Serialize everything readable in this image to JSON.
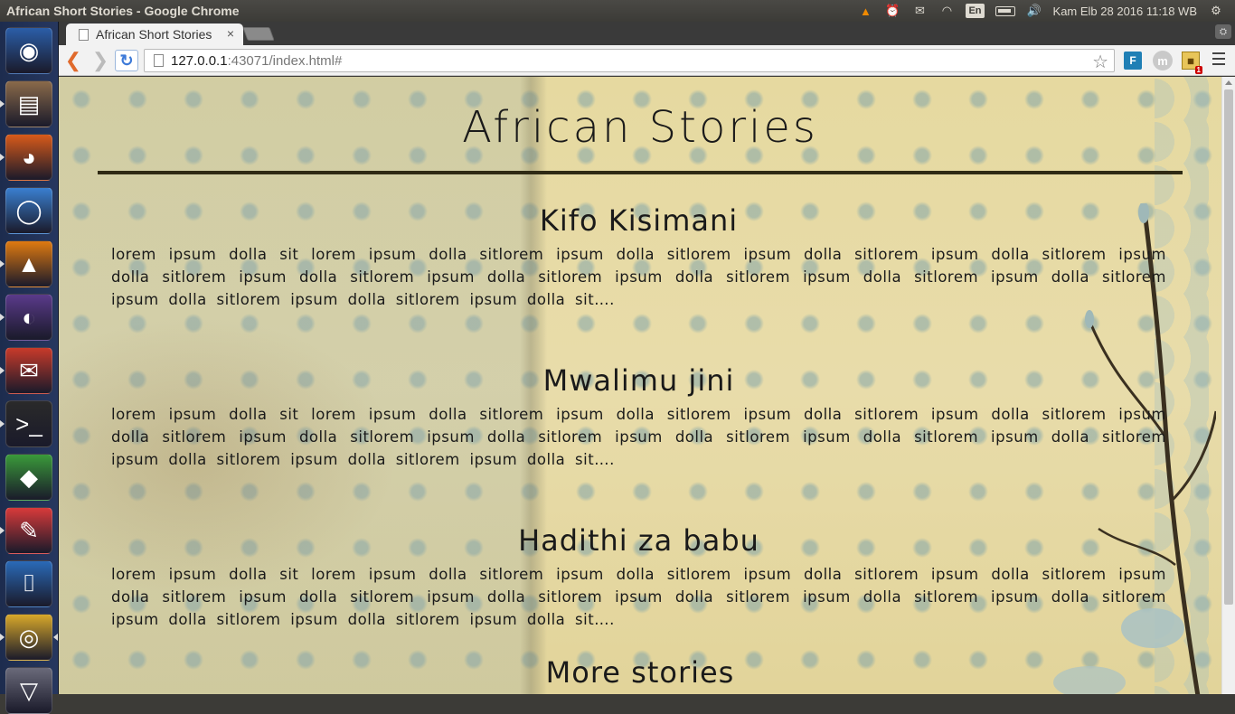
{
  "os": {
    "window_title": "African Short Stories - Google Chrome",
    "language": "En",
    "clock": "Kam Elb 28 2016 11:18 WB"
  },
  "browser": {
    "tab_title": "African Short Stories",
    "tab_close": "×",
    "url_host": "127.0.0.1",
    "url_rest": ":43071/index.html#",
    "extension_f": "F",
    "extension_m": "m",
    "extension_badge": "1"
  },
  "page": {
    "title": "African Stories",
    "stories": [
      {
        "heading": "Kifo Kisimani",
        "body": "lorem ipsum dolla sit lorem ipsum dolla sitlorem ipsum dolla sitlorem ipsum dolla sitlorem ipsum dolla sitlorem ipsum dolla sitlorem ipsum dolla sitlorem ipsum dolla sitlorem ipsum dolla sitlorem ipsum dolla sitlorem ipsum dolla sitlorem ipsum dolla sitlorem ipsum dolla sitlorem ipsum dolla sit…."
      },
      {
        "heading": "Mwalimu jini",
        "body": "lorem ipsum dolla sit lorem ipsum dolla sitlorem ipsum dolla sitlorem ipsum dolla sitlorem ipsum dolla sitlorem ipsum dolla sitlorem ipsum dolla sitlorem ipsum dolla sitlorem ipsum dolla sitlorem ipsum dolla sitlorem ipsum dolla sitlorem ipsum dolla sitlorem ipsum dolla sitlorem ipsum dolla sit…."
      },
      {
        "heading": "Hadithi za babu",
        "body": "lorem ipsum dolla sit lorem ipsum dolla sitlorem ipsum dolla sitlorem ipsum dolla sitlorem ipsum dolla sitlorem ipsum dolla sitlorem ipsum dolla sitlorem ipsum dolla sitlorem ipsum dolla sitlorem ipsum dolla sitlorem ipsum dolla sitlorem ipsum dolla sitlorem ipsum dolla sitlorem ipsum dolla sit…."
      }
    ],
    "more_link": "More stories"
  },
  "launcher_apps": [
    {
      "name": "dash-home-icon",
      "color": "#2b5ea8",
      "glyph": "◉"
    },
    {
      "name": "files-icon",
      "color": "#8a6a4a",
      "glyph": "▤"
    },
    {
      "name": "firefox-icon",
      "color": "#d85a1a",
      "glyph": "◕"
    },
    {
      "name": "chromium-icon",
      "color": "#3a7fd0",
      "glyph": "◯"
    },
    {
      "name": "vlc-icon",
      "color": "#e07a10",
      "glyph": "▲"
    },
    {
      "name": "eclipse-icon",
      "color": "#5a3a8a",
      "glyph": "◐"
    },
    {
      "name": "thunderbird-icon",
      "color": "#c83a2a",
      "glyph": "✉"
    },
    {
      "name": "terminal-icon",
      "color": "#2a2a2a",
      "glyph": ">_"
    },
    {
      "name": "cube-app-icon",
      "color": "#3a9a3a",
      "glyph": "◆"
    },
    {
      "name": "pdf-reader-icon",
      "color": "#d83a3a",
      "glyph": "✎"
    },
    {
      "name": "bracket-app-icon",
      "color": "#2a6ab8",
      "glyph": "⌷"
    },
    {
      "name": "chrome-icon",
      "color": "#d8a82a",
      "glyph": "◎"
    },
    {
      "name": "trash-icon",
      "color": "#6a6a7a",
      "glyph": "▽"
    }
  ]
}
